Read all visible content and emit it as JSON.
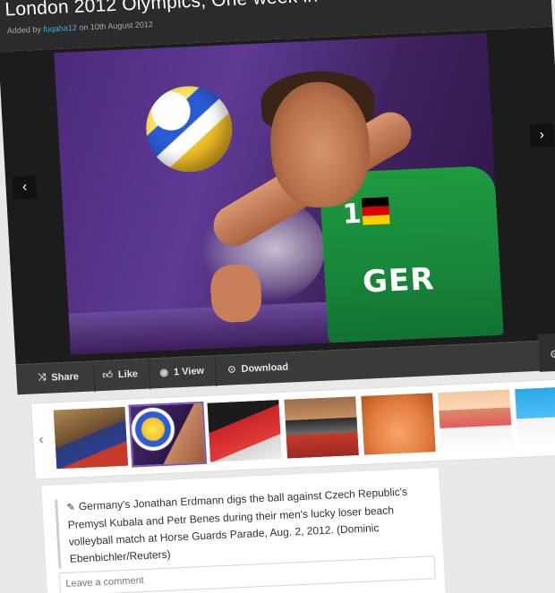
{
  "header": {
    "title": "London 2012 Olympics, One week in",
    "meta_prefix": "Added by",
    "meta_user": "fuqaha12",
    "meta_suffix": "on 10th August 2012"
  },
  "viewer": {
    "jersey_number": "1",
    "jersey_text": "GER",
    "prev_icon": "chevron-left-icon",
    "next_icon": "chevron-right-icon"
  },
  "actions": {
    "share": "Share",
    "like": "Like",
    "views": "1 View",
    "download": "Download"
  },
  "strip": {
    "prev_glyph": "‹",
    "next_glyph": "›",
    "thumbnails": 7,
    "active_index": 1
  },
  "caption": {
    "text": "Germany's Jonathan Erdmann digs the ball against Czech Republic's Premysl Kubala and Petr Benes during their men's lucky loser beach volleyball match at Horse Guards Parade, Aug. 2, 2012. (Dominic Ebenbichler/Reuters)",
    "comment_placeholder": "Leave a comment"
  },
  "colors": {
    "header_bg": "#2b2b2b",
    "link_blue": "#48a6e6",
    "action_bar": "#3a3a3a",
    "thumb_active_border": "#7a5bb7"
  }
}
